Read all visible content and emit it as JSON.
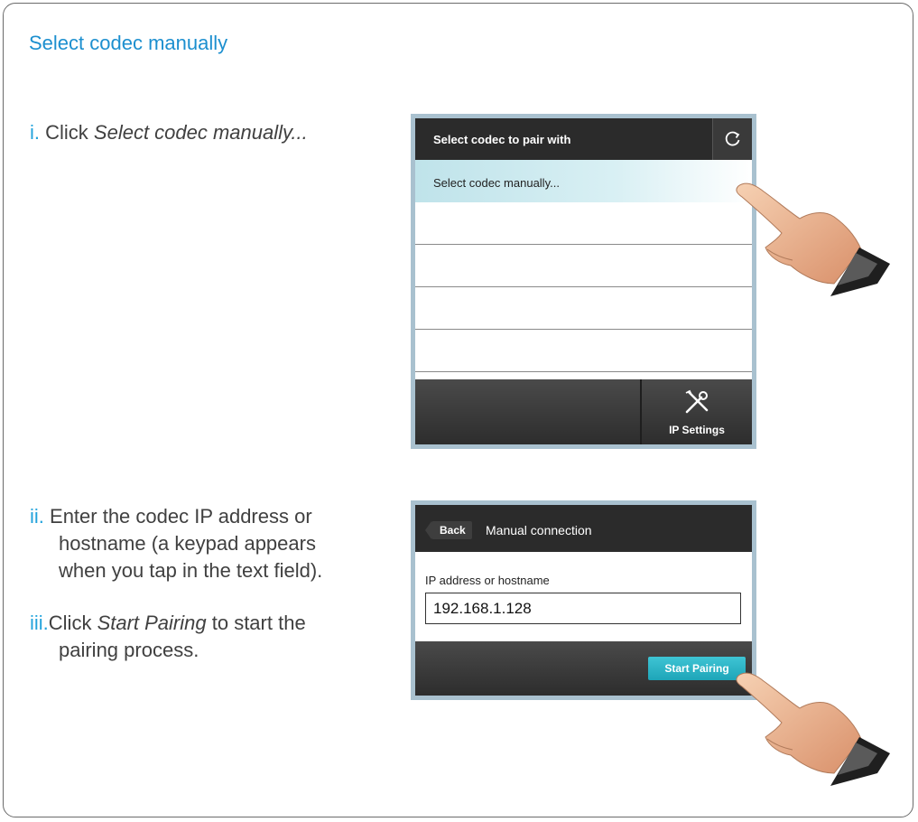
{
  "section_title": "Select codec manually",
  "steps": [
    {
      "num": "i.",
      "pre": "Click ",
      "em": "Select codec manually...",
      "post": ""
    },
    {
      "num": "ii.",
      "line1": "Enter the codec IP address or",
      "line2": "hostname (a keypad appears",
      "line3": "when you tap in the text field)."
    },
    {
      "num": "iii.",
      "em": "Start Pairing",
      "pre": "Click ",
      "post": " to start the",
      "line2": "pairing process."
    }
  ],
  "screen1": {
    "header_title": "Select codec to pair with",
    "refresh_icon": "refresh-icon",
    "selected_row": "Select codec manually...",
    "ip_settings_label": "IP Settings",
    "tools_icon": "tools-icon"
  },
  "screen2": {
    "back_label": "Back",
    "header_title": "Manual connection",
    "field_label": "IP address or hostname",
    "field_value": "192.168.1.128",
    "start_label": "Start Pairing"
  },
  "colors": {
    "accent": "#1c8fcf",
    "step_number": "#23a3dc",
    "start_button": "#2cb5c8",
    "selected_row": "#c7e8ee"
  }
}
